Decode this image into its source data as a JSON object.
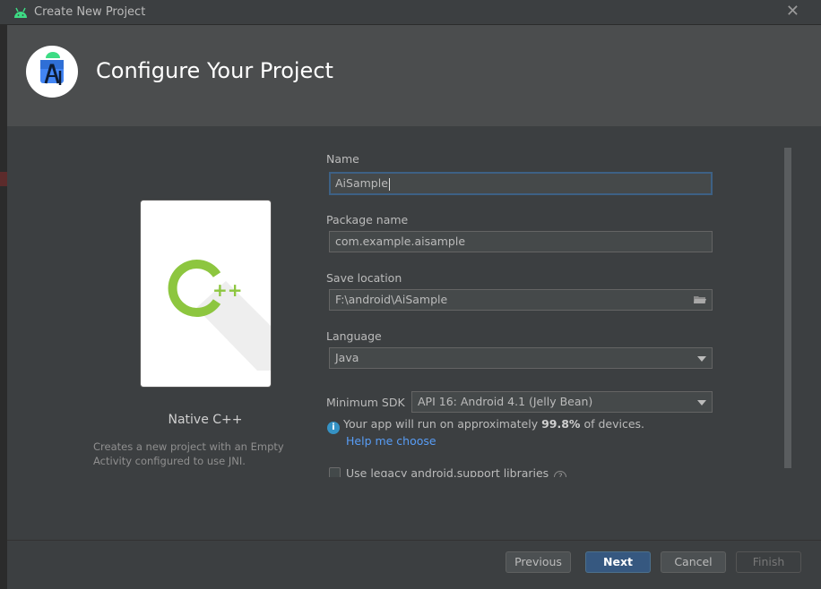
{
  "window": {
    "title": "Create New Project",
    "close_glyph": "✕"
  },
  "header": {
    "title": "Configure Your Project"
  },
  "template": {
    "name": "Native C++",
    "description": "Creates a new project with an Empty Activity configured to use JNI."
  },
  "form": {
    "name_label": "Name",
    "name_value": "AiSample",
    "package_label": "Package name",
    "package_value": "com.example.aisample",
    "location_label": "Save location",
    "location_value": "F:\\android\\AiSample",
    "language_label": "Language",
    "language_value": "Java",
    "min_sdk_label": "Minimum SDK",
    "min_sdk_value": "API 16: Android 4.1 (Jelly Bean)",
    "info_prefix": "Your app will run on approximately",
    "info_percent": "99.8%",
    "info_suffix": "of devices.",
    "help_link": "Help me choose",
    "legacy_label": "Use legacy android.support libraries",
    "legacy_checked": false
  },
  "buttons": {
    "previous": "Previous",
    "next": "Next",
    "cancel": "Cancel",
    "finish": "Finish"
  },
  "colors": {
    "accent": "#365880",
    "link": "#589df6",
    "android_green": "#3ddc84",
    "cpp_green": "#8dc63f"
  }
}
